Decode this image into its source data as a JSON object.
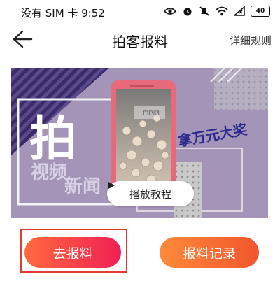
{
  "status_bar": {
    "text": "没有 SIM 卡 9:52",
    "battery": "40"
  },
  "header": {
    "title": "拍客报料",
    "rules_label": "详细规则"
  },
  "banner": {
    "big_char": "拍",
    "vertical_text_1": "视频",
    "vertical_text_2": "新闻",
    "slogan": "拿万元大奖",
    "play_label": "播放教程"
  },
  "actions": {
    "report_label": "去报料",
    "records_label": "报料记录"
  },
  "colors": {
    "banner_bg": "#a394b8",
    "report_button": "#f01f55",
    "records_button": "#f2562d",
    "highlight": "#e53935",
    "slogan": "#2a2a8c"
  }
}
